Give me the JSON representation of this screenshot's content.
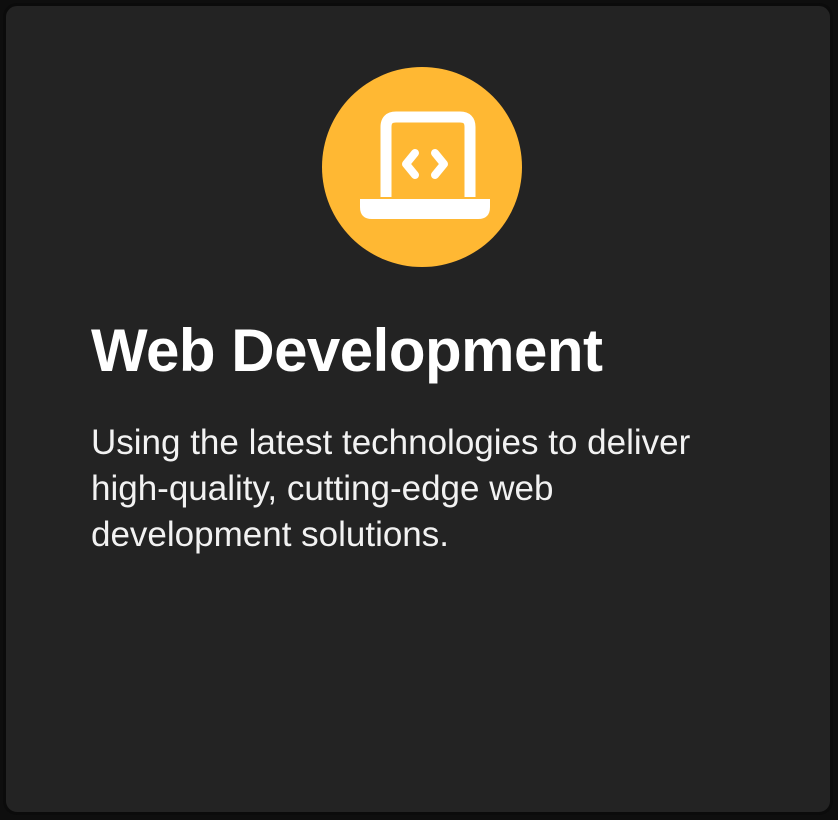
{
  "card": {
    "icon": "laptop-code-icon",
    "accent_color": "#FFB833",
    "background_color": "#232323",
    "title": "Web Development",
    "description": "Using the latest technologies to deliver high-quality, cutting-edge web development solutions."
  }
}
